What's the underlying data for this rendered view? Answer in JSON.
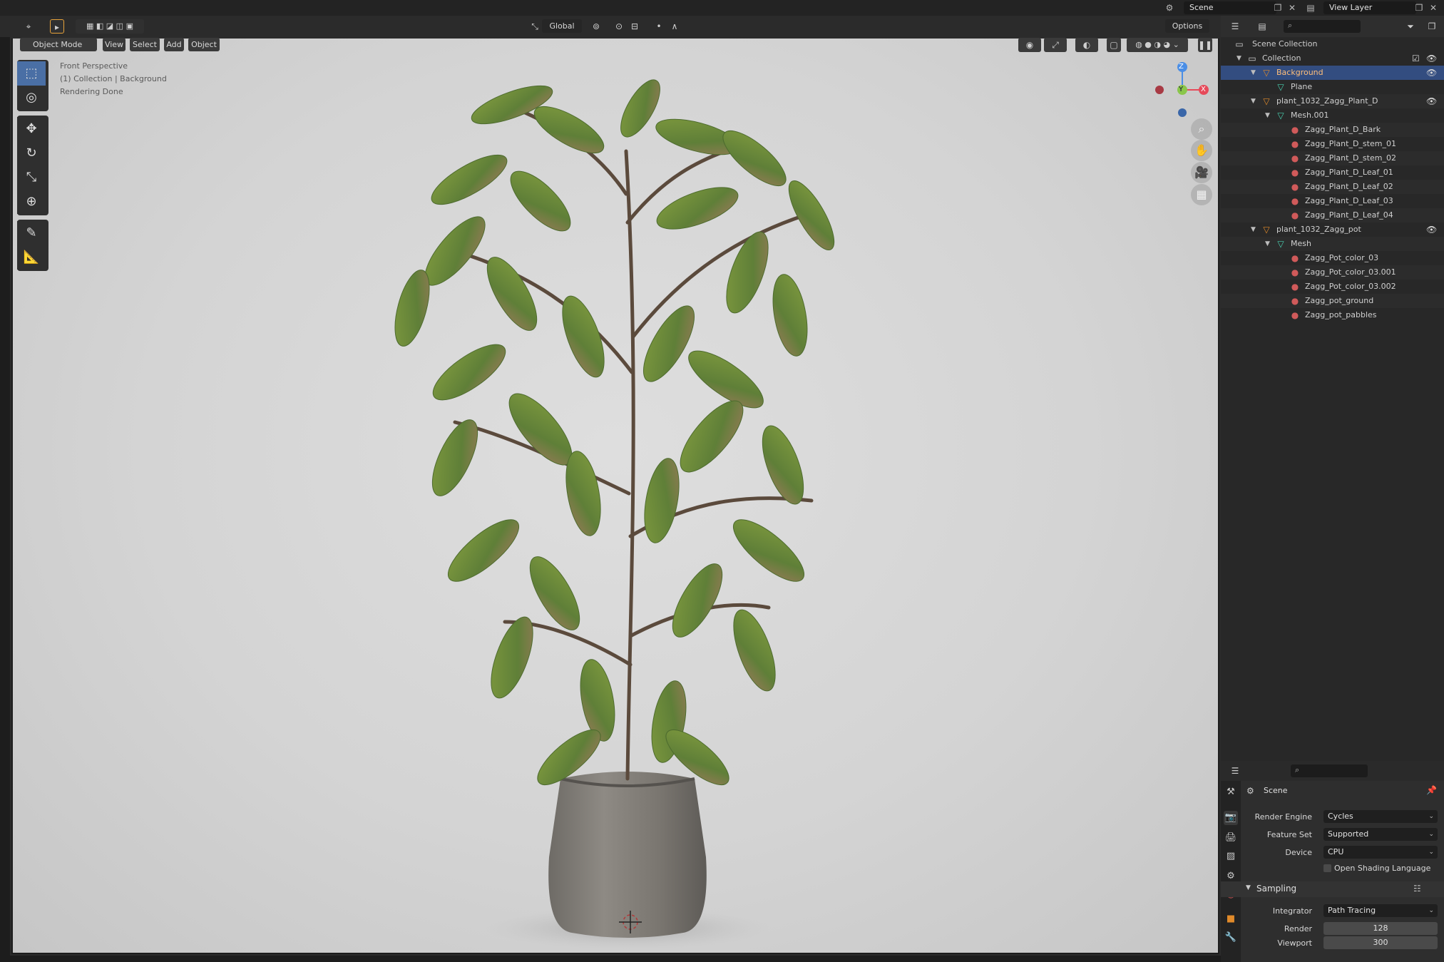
{
  "topbar": {
    "scene_label": "Scene",
    "view_layer_label": "View Layer",
    "options_label": "Options"
  },
  "viewport": {
    "mode_label": "Object Mode",
    "menus": [
      "View",
      "Select",
      "Add",
      "Object"
    ],
    "transform_orientation": "Global",
    "overlay_lines": [
      "Front Perspective",
      "(1) Collection | Background",
      "Rendering Done"
    ],
    "gizmo_axes": {
      "z": "Z",
      "y": "Y",
      "x": "X"
    },
    "colors": {
      "x_axis": "#e64a5a",
      "y_axis": "#8ac64a",
      "z_axis": "#4a8ee6"
    }
  },
  "outliner": {
    "root": "Scene Collection",
    "rows": [
      {
        "label": "Collection",
        "icon": "collection-icon",
        "level": 0
      },
      {
        "label": "Background",
        "icon": "mesh-object-icon",
        "level": 1,
        "selected": true
      },
      {
        "label": "Plane",
        "icon": "mesh-data-icon",
        "level": 2
      },
      {
        "label": "plant_1032_Zagg_Plant_D",
        "icon": "mesh-object-icon",
        "level": 1
      },
      {
        "label": "Mesh.001",
        "icon": "mesh-data-icon",
        "level": 2
      },
      {
        "label": "Zagg_Plant_D_Bark",
        "icon": "material-icon",
        "level": 3
      },
      {
        "label": "Zagg_Plant_D_stem_01",
        "icon": "material-icon",
        "level": 3
      },
      {
        "label": "Zagg_Plant_D_stem_02",
        "icon": "material-icon",
        "level": 3
      },
      {
        "label": "Zagg_Plant_D_Leaf_01",
        "icon": "material-icon",
        "level": 3
      },
      {
        "label": "Zagg_Plant_D_Leaf_02",
        "icon": "material-icon",
        "level": 3
      },
      {
        "label": "Zagg_Plant_D_Leaf_03",
        "icon": "material-icon",
        "level": 3
      },
      {
        "label": "Zagg_Plant_D_Leaf_04",
        "icon": "material-icon",
        "level": 3
      },
      {
        "label": "plant_1032_Zagg_pot",
        "icon": "mesh-object-icon",
        "level": 1
      },
      {
        "label": "Mesh",
        "icon": "mesh-data-icon",
        "level": 2
      },
      {
        "label": "Zagg_Pot_color_03",
        "icon": "material-icon",
        "level": 3
      },
      {
        "label": "Zagg_Pot_color_03.001",
        "icon": "material-icon",
        "level": 3
      },
      {
        "label": "Zagg_Pot_color_03.002",
        "icon": "material-icon",
        "level": 3
      },
      {
        "label": "Zagg_pot_ground",
        "icon": "material-icon",
        "level": 3
      },
      {
        "label": "Zagg_pot_pabbles",
        "icon": "material-icon",
        "level": 3
      }
    ]
  },
  "properties": {
    "context": "Scene",
    "render_engine_label": "Render Engine",
    "render_engine": "Cycles",
    "feature_set_label": "Feature Set",
    "feature_set": "Supported",
    "device_label": "Device",
    "device": "CPU",
    "osl_label": "Open Shading Language",
    "sampling_label": "Sampling",
    "integrator_label": "Integrator",
    "integrator": "Path Tracing",
    "render_label": "Render",
    "render_samples": "128",
    "viewport_label": "Viewport",
    "viewport_samples": "300"
  }
}
